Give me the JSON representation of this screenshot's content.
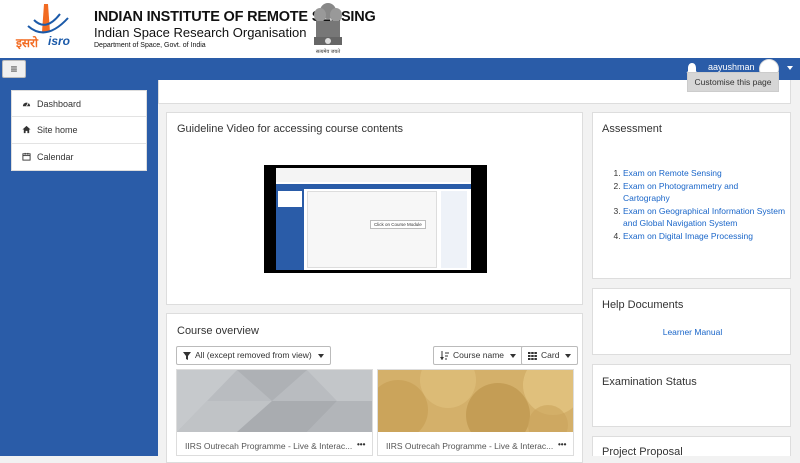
{
  "header": {
    "logo_text_hindi": "इसरो",
    "logo_text_latin": "isro",
    "institute_name": "INDIAN INSTITUTE OF REMOTE SENSING",
    "organisation": "Indian Space Research Organisation",
    "department": "Department of Space, Govt. of India",
    "emblem_caption": "सत्यमेव जयते"
  },
  "navbar": {
    "menu_toggle": "≡",
    "user_name": "aayushman"
  },
  "nav_drawer": {
    "items": [
      {
        "label": "Dashboard",
        "icon": "dashboard-icon"
      },
      {
        "label": "Site home",
        "icon": "home-icon"
      },
      {
        "label": "Calendar",
        "icon": "calendar-icon"
      }
    ]
  },
  "page": {
    "customise_button": "Customise this page"
  },
  "guideline": {
    "title": "Guideline Video for accessing course contents",
    "video_annotation": "Click on Course Module"
  },
  "course_overview": {
    "title": "Course overview",
    "filter_label": "All (except removed from view)",
    "sort_label": "Course name",
    "view_label": "Card",
    "courses": [
      {
        "name": "IIRS Outrecah Programme - Live & Interac...",
        "more": "•••"
      },
      {
        "name": "IIRS Outrecah Programme - Live & Interac...",
        "more": "•••"
      }
    ]
  },
  "assessment": {
    "title": "Assessment",
    "items": [
      "Exam on Remote Sensing",
      "Exam on Photogrammetry and Cartography",
      "Exam on Geographical Information System and Global Navigation System",
      "Exam on Digital Image Processing"
    ]
  },
  "help_documents": {
    "title": "Help Documents",
    "link": "Learner Manual"
  },
  "examination_status": {
    "title": "Examination Status"
  },
  "project_proposal": {
    "title": "Project Proposal"
  },
  "colors": {
    "navbar": "#2a5ca8",
    "link": "#1a66c9",
    "logo_orange": "#f26b22",
    "logo_blue": "#1b5aa9"
  }
}
